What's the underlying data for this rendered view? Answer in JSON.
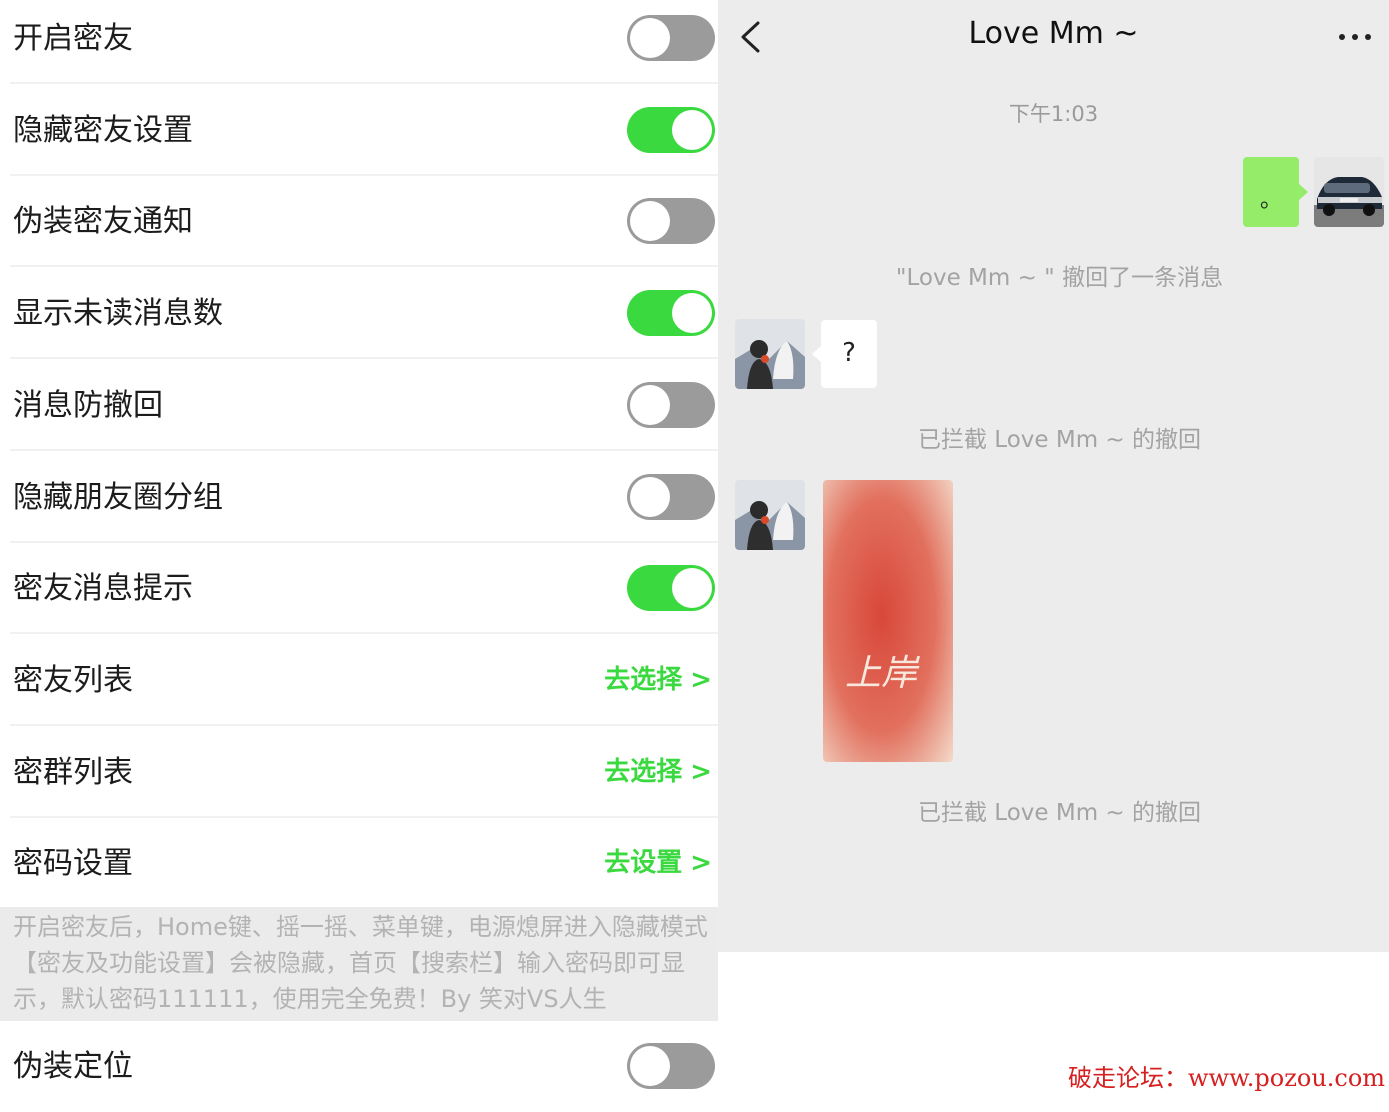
{
  "settings": {
    "rows": [
      {
        "label": "开启密友",
        "type": "toggle",
        "on": false
      },
      {
        "label": "隐藏密友设置",
        "type": "toggle",
        "on": true
      },
      {
        "label": "伪装密友通知",
        "type": "toggle",
        "on": false
      },
      {
        "label": "显示未读消息数",
        "type": "toggle",
        "on": true
      },
      {
        "label": "消息防撤回",
        "type": "toggle",
        "on": false
      },
      {
        "label": "隐藏朋友圈分组",
        "type": "toggle",
        "on": false
      },
      {
        "label": "密友消息提示",
        "type": "toggle",
        "on": true
      },
      {
        "label": "密友列表",
        "type": "link",
        "link_text": "去选择",
        "chevron": ">"
      },
      {
        "label": "密群列表",
        "type": "link",
        "link_text": "去选择",
        "chevron": ">"
      },
      {
        "label": "密码设置",
        "type": "link",
        "link_text": "去设置",
        "chevron": ">"
      }
    ],
    "note": "开启密友后，Home键、摇一摇、菜单键，电源熄屏进入隐藏模式【密友及功能设置】会被隐藏，首页【搜索栏】输入密码即可显示，默认密码111111，使用完全免费！By 笑对VS人生",
    "last_row": {
      "label": "伪装定位",
      "type": "toggle",
      "on": false
    },
    "colors": {
      "toggle_on": "#3ad93f",
      "toggle_off": "#9b9b9b",
      "link": "#3ad93f"
    }
  },
  "chat": {
    "title": "Love Mm ~",
    "back_icon": "chevron-left-icon",
    "more_icon": "more-dots-icon",
    "timestamp": "下午1:03",
    "my_message": "。",
    "recall_notice": "\"Love Mm ~ \" 撤回了一条消息",
    "their_message": "?",
    "intercept_notice_1": "已拦截 Love Mm ~ 的撤回",
    "image_caption": "上岸",
    "intercept_notice_2": "已拦截 Love Mm ~ 的撤回",
    "colors": {
      "my_bubble": "#95ec69",
      "background": "#ececec"
    }
  },
  "watermark": "破走论坛：www.pozou.com"
}
